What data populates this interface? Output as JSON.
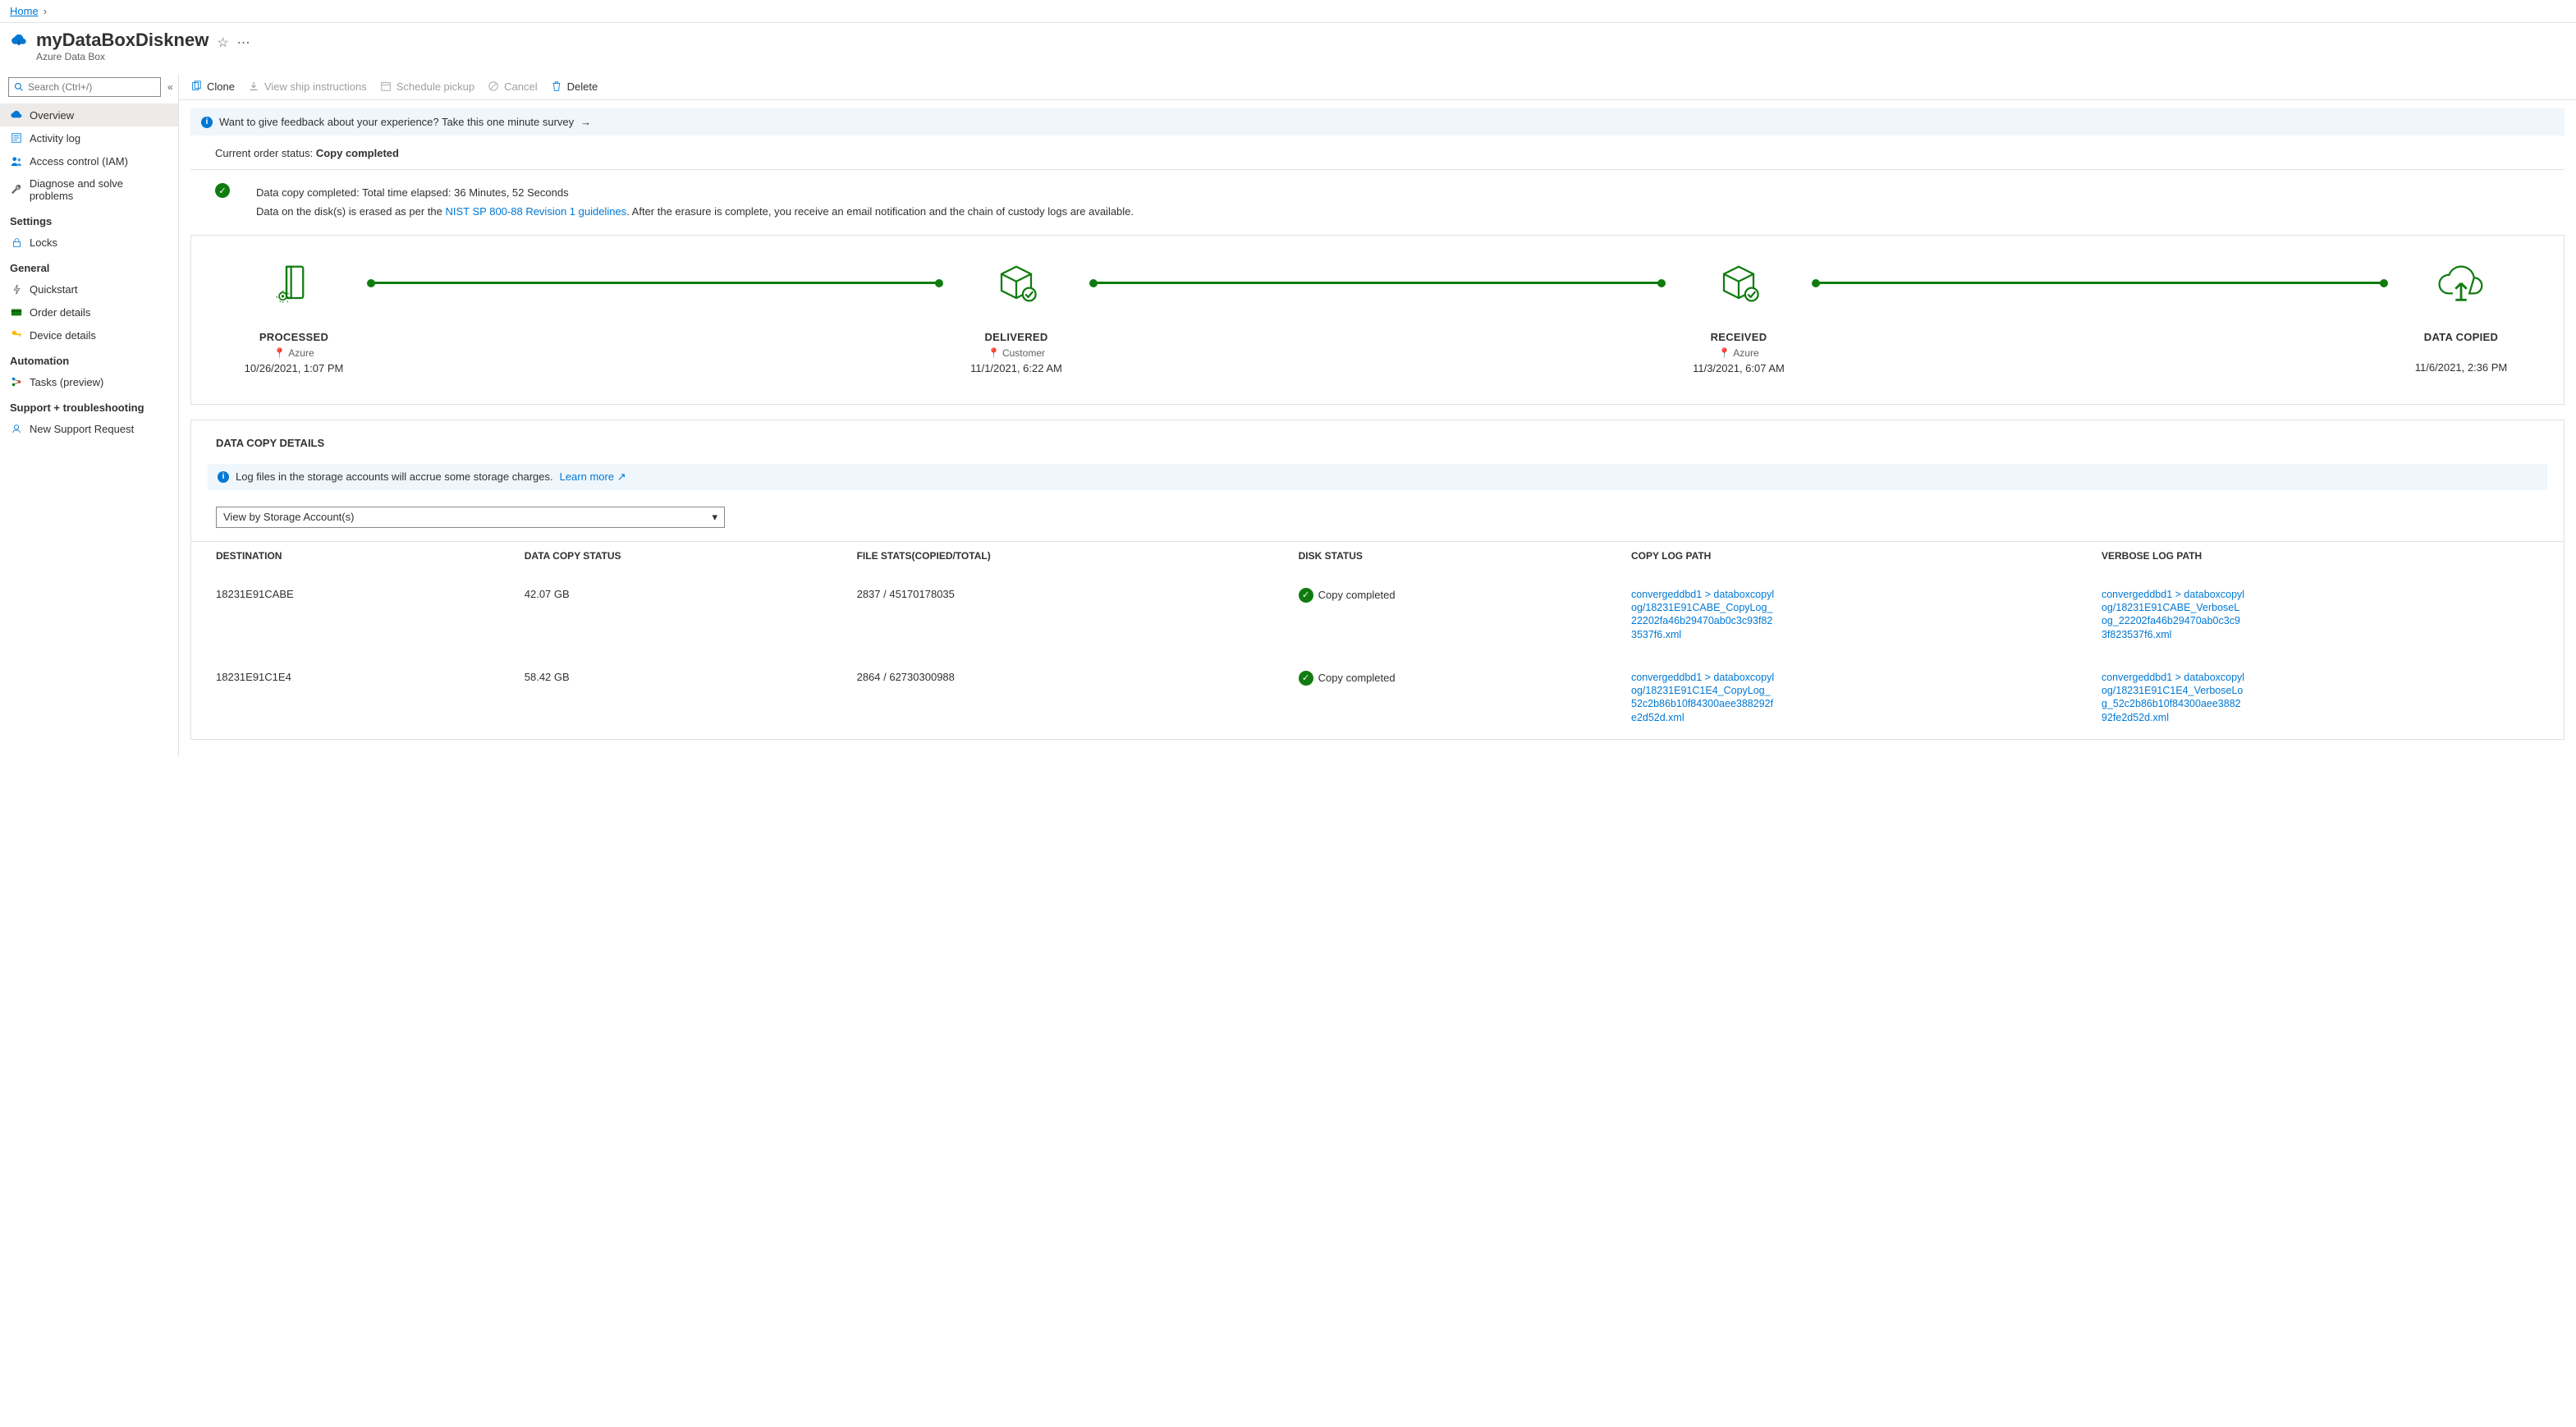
{
  "breadcrumb": {
    "home": "Home"
  },
  "header": {
    "title": "myDataBoxDisknew",
    "subtitle": "Azure Data Box"
  },
  "search": {
    "placeholder": "Search (Ctrl+/)"
  },
  "nav": {
    "overview": "Overview",
    "activity": "Activity log",
    "iam": "Access control (IAM)",
    "diagnose": "Diagnose and solve problems",
    "settings_group": "Settings",
    "locks": "Locks",
    "general_group": "General",
    "quickstart": "Quickstart",
    "order": "Order details",
    "device": "Device details",
    "automation_group": "Automation",
    "tasks": "Tasks (preview)",
    "support_group": "Support + troubleshooting",
    "support": "New Support Request"
  },
  "toolbar": {
    "clone": "Clone",
    "view_ship": "View ship instructions",
    "schedule": "Schedule pickup",
    "cancel": "Cancel",
    "delete": "Delete"
  },
  "feedback": {
    "text": "Want to give feedback about your experience? Take this one minute survey"
  },
  "status": {
    "label": "Current order status: ",
    "value": "Copy completed"
  },
  "summary": {
    "line1": "Data copy completed: Total time elapsed: 36 Minutes, 52 Seconds",
    "line2_pre": "Data on the disk(s) is erased as per the ",
    "line2_link": "NIST SP 800-88 Revision 1 guidelines",
    "line2_post": ". After the erasure is complete, you receive an email notification and the chain of custody logs are available."
  },
  "stages": [
    {
      "title": "PROCESSED",
      "location": "Azure",
      "date": "10/26/2021, 1:07 PM"
    },
    {
      "title": "DELIVERED",
      "location": "Customer",
      "date": "11/1/2021, 6:22 AM"
    },
    {
      "title": "RECEIVED",
      "location": "Azure",
      "date": "11/3/2021, 6:07 AM"
    },
    {
      "title": "DATA COPIED",
      "location": "",
      "date": "11/6/2021, 2:36 PM"
    }
  ],
  "details": {
    "title": "DATA COPY DETAILS",
    "info_text": "Log files in the storage accounts will accrue some storage charges.  ",
    "learn_more": "Learn more",
    "dropdown": "View by Storage Account(s)",
    "columns": {
      "dest": "DESTINATION",
      "status": "DATA COPY STATUS",
      "stats": "FILE STATS(COPIED/TOTAL)",
      "disk": "DISK STATUS",
      "copylog": "COPY LOG PATH",
      "verbose": "VERBOSE LOG PATH"
    },
    "rows": [
      {
        "dest": "18231E91CABE",
        "status": "42.07 GB",
        "stats": "2837 / 45170178035",
        "disk": "Copy completed",
        "copylog": "convergeddbd1 > databoxcopylog/18231E91CABE_CopyLog_22202fa46b29470ab0c3c93f823537f6.xml",
        "verbose": "convergeddbd1 > databoxcopylog/18231E91CABE_VerboseLog_22202fa46b29470ab0c3c93f823537f6.xml"
      },
      {
        "dest": "18231E91C1E4",
        "status": "58.42 GB",
        "stats": "2864 / 62730300988",
        "disk": "Copy completed",
        "copylog": "convergeddbd1 > databoxcopylog/18231E91C1E4_CopyLog_52c2b86b10f84300aee388292fe2d52d.xml",
        "verbose": "convergeddbd1 > databoxcopylog/18231E91C1E4_VerboseLog_52c2b86b10f84300aee388292fe2d52d.xml"
      }
    ]
  }
}
